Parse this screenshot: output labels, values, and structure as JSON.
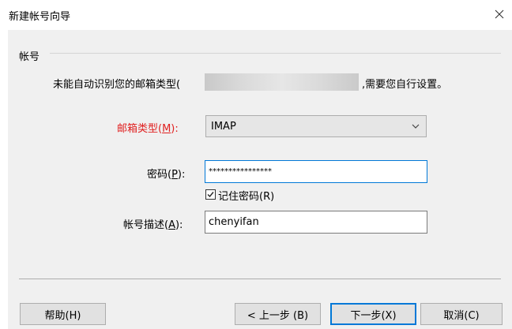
{
  "window": {
    "title": "新建帐号向导",
    "close_icon": "close-icon"
  },
  "group": {
    "label": "帐号"
  },
  "info": {
    "prefix": "未能自动识别您的邮箱类型(",
    "suffix": ",需要您自行设置。"
  },
  "fields": {
    "mailbox_type": {
      "label": "邮箱类型(",
      "accel": "M",
      "label_end": "):",
      "value": "IMAP",
      "label_color": "#e02020"
    },
    "password": {
      "label": "密码(",
      "accel": "P",
      "label_end": "):",
      "value": "****************"
    },
    "remember_password": {
      "label": "记住密码(R)",
      "checked": true
    },
    "description": {
      "label": "帐号描述(",
      "accel": "A",
      "label_end": "):",
      "value": "chenyifan"
    }
  },
  "buttons": {
    "help": "帮助(H)",
    "back": "< 上一步 (B)",
    "next": "下一步(X)",
    "cancel": "取消(C)"
  },
  "colors": {
    "accent": "#0078d7",
    "error_label": "#e02020",
    "dialog_bg": "#f0f0f0"
  }
}
